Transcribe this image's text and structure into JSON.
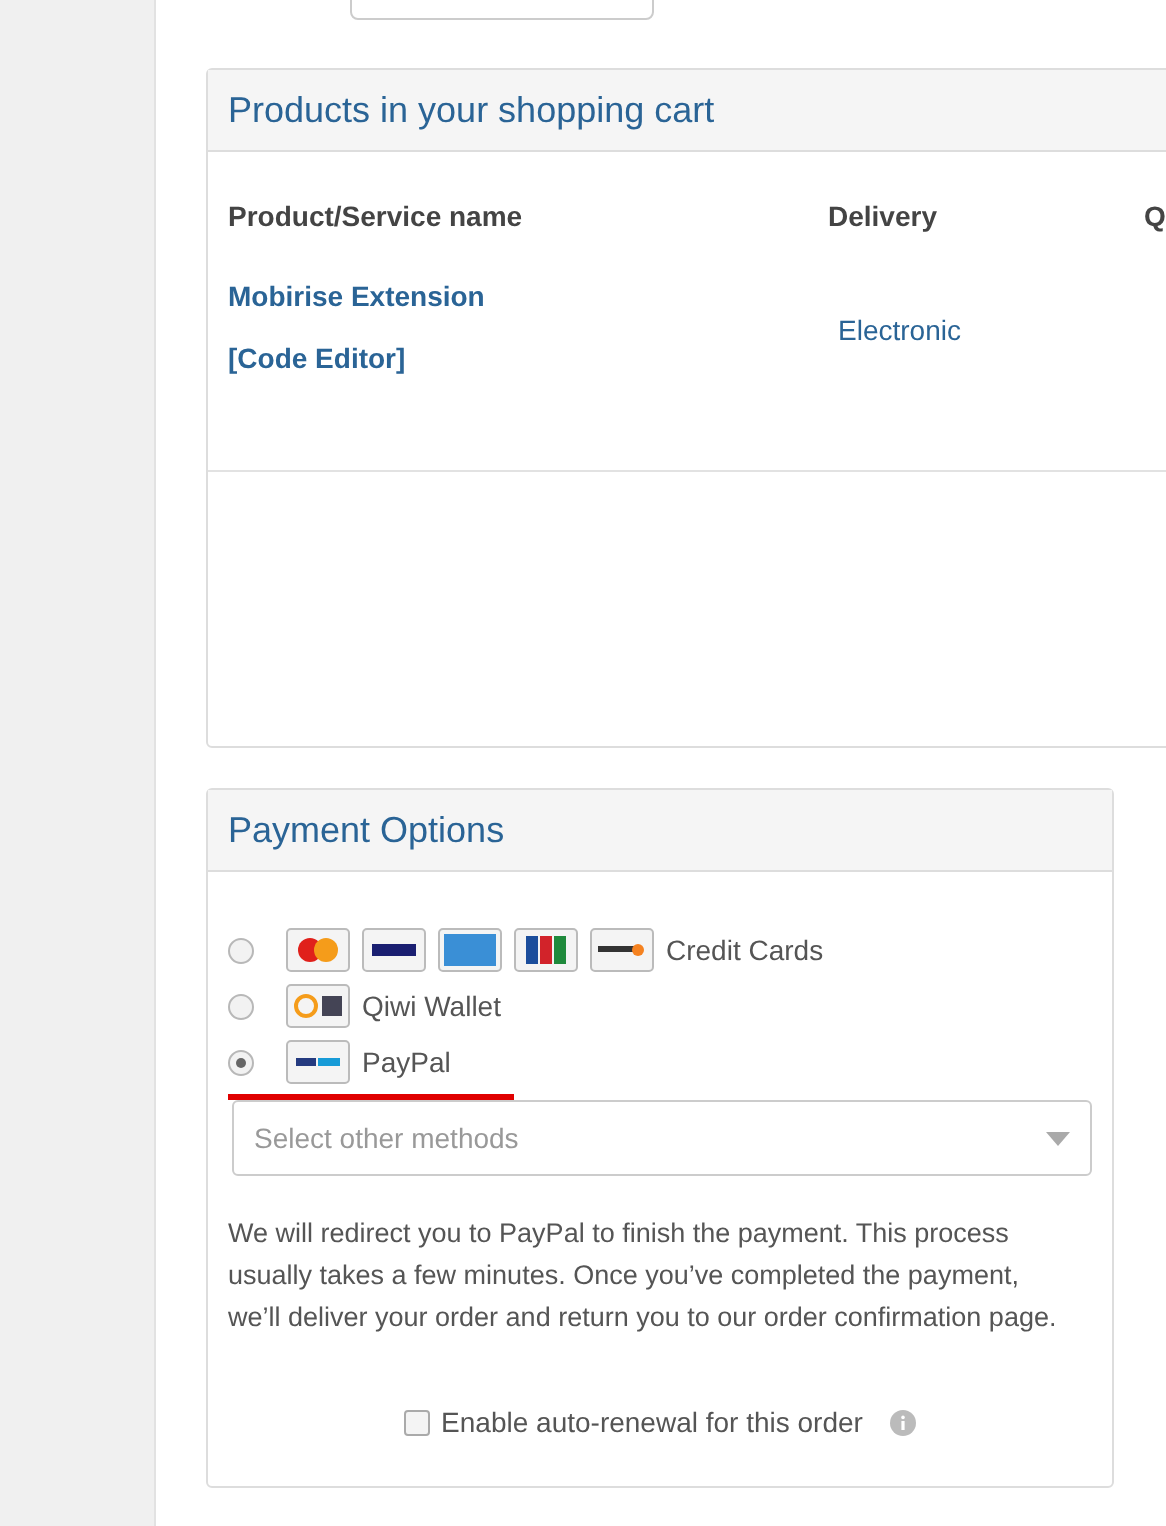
{
  "cart": {
    "title": "Products in your shopping cart",
    "columns": [
      "Product/Service name",
      "Delivery",
      "Q"
    ],
    "rows": [
      {
        "product": [
          "Mobirise Extension",
          "[Code Editor]"
        ],
        "delivery": "Electronic"
      }
    ]
  },
  "payment": {
    "title": "Payment Options",
    "options": [
      {
        "kind": "cards",
        "label": "Credit Cards",
        "selected": false
      },
      {
        "kind": "qiwi",
        "label": "Qiwi Wallet",
        "selected": false
      },
      {
        "kind": "paypal",
        "label": "PayPal",
        "selected": true
      }
    ],
    "select": {
      "placeholder": "Select other methods"
    },
    "note": "We will redirect you to PayPal to finish the payment. This process usually takes a few minutes. Once you’ve completed the payment, we’ll deliver your order and return you to our order confirmation page.",
    "auto_renewal": {
      "label": "Enable auto-renewal for this order",
      "checked": false
    }
  }
}
